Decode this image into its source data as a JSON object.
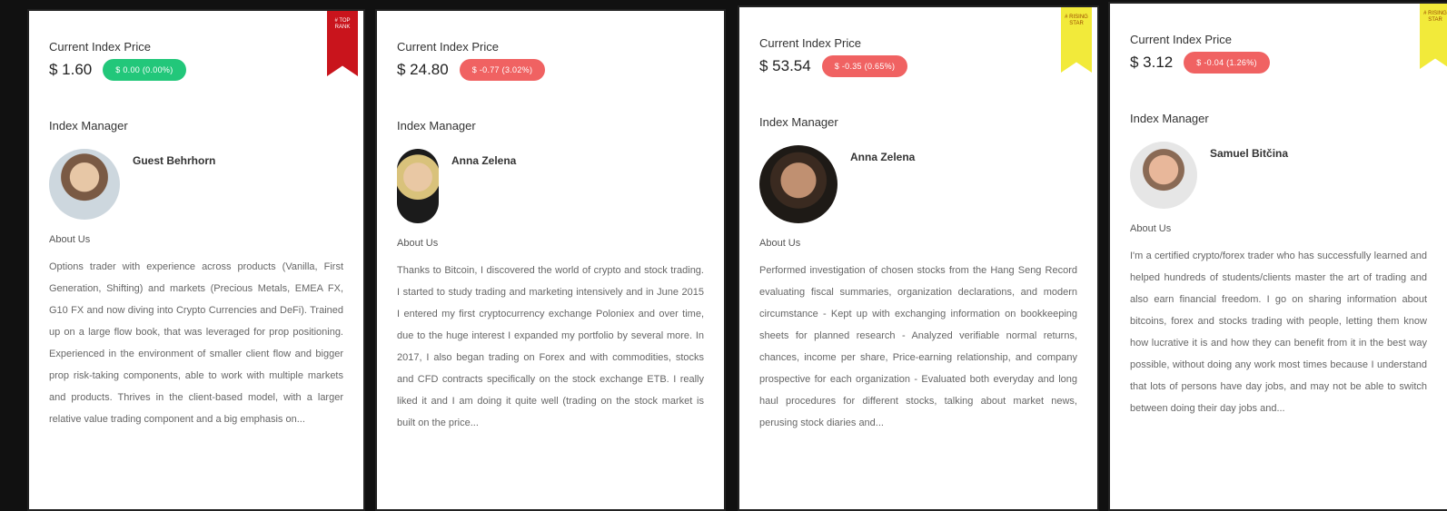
{
  "cards": [
    {
      "price_label": "Current Index Price",
      "price": "$ 1.60",
      "change": "$ 0.00 (0.00%)",
      "change_color": "#22c77a",
      "ribbon": "# TOP RANK",
      "ribbon_color": "#c9141c",
      "manager_label": "Index Manager",
      "manager_name": "Guest Behrhorn",
      "about_label": "About Us",
      "about": "Options trader with experience across products (Vanilla, First Generation, Shifting) and markets (Precious Metals, EMEA FX, G10 FX and now diving into Crypto Currencies and DeFi). Trained up on a large flow book, that was leveraged for prop positioning. Experienced in the environment of smaller client flow and bigger prop risk-taking components, able to work with multiple markets and products. Thrives in the client-based model, with a larger relative value trading component and a big emphasis on..."
    },
    {
      "price_label": "Current Index Price",
      "price": "$ 24.80",
      "change": "$ -0.77 (3.02%)",
      "change_color": "#f06262",
      "manager_label": "Index Manager",
      "manager_name": "Anna Zelena",
      "about_label": "About Us",
      "about": "Thanks to Bitcoin, I discovered the world of crypto and stock trading. I started to study trading and marketing intensively and in June 2015 I entered my first cryptocurrency exchange Poloniex and over time, due to the huge interest I expanded my portfolio by several more. In 2017, I also began trading on Forex and with commodities, stocks and CFD contracts specifically on the stock exchange ETB. I really liked it and I am doing it quite well (trading on the stock market is built on the price..."
    },
    {
      "price_label": "Current Index Price",
      "price": "$ 53.54",
      "change": "$ -0.35 (0.65%)",
      "change_color": "#f06262",
      "ribbon": "# RISING STAR",
      "ribbon_color": "#f2ea3a",
      "manager_label": "Index Manager",
      "manager_name": "Anna Zelena",
      "about_label": "About Us",
      "about": "Performed investigation of chosen stocks from the Hang Seng Record evaluating fiscal summaries, organization declarations, and modern circumstance - Kept up with exchanging information on bookkeeping sheets for planned research - Analyzed verifiable normal returns, chances, income per share, Price-earning relationship, and company prospective for each organization - Evaluated both everyday and long haul procedures for different stocks, talking about market news, perusing stock diaries and..."
    },
    {
      "price_label": "Current Index Price",
      "price": "$ 3.12",
      "change": "$ -0.04 (1.26%)",
      "change_color": "#f06262",
      "ribbon": "# RISING STAR",
      "ribbon_color": "#f2ea3a",
      "manager_label": "Index Manager",
      "manager_name": "Samuel Bitčina",
      "about_label": "About Us",
      "about": "I'm a certified crypto/forex trader who has successfully learned and helped hundreds of students/clients master the art of trading and also earn financial freedom. I go on sharing information about bitcoins, forex and stocks trading with people, letting them know how lucrative it is and how they can benefit from it in the best way possible, without doing any work most times because I understand that lots of persons have day jobs, and may not be able to switch between doing their day jobs and..."
    }
  ]
}
